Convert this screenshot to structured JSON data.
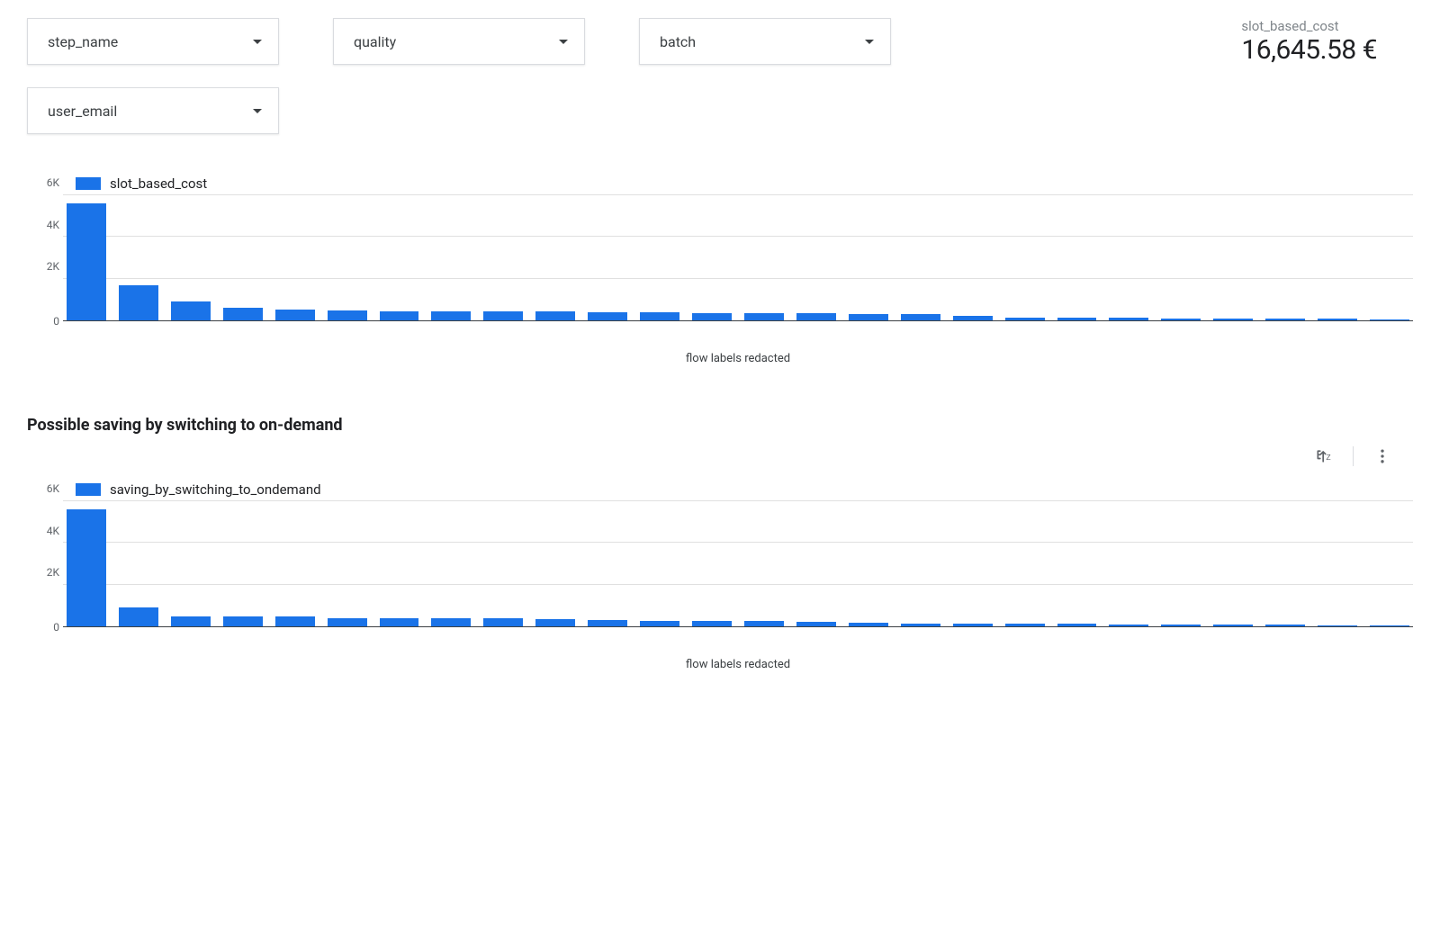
{
  "filters": {
    "step_name": {
      "label": "step_name"
    },
    "quality": {
      "label": "quality"
    },
    "batch": {
      "label": "batch"
    },
    "user_email": {
      "label": "user_email"
    }
  },
  "scorecard": {
    "label": "slot_based_cost",
    "value": "16,645.58 €"
  },
  "chart1": {
    "legend": "slot_based_cost",
    "x_caption": "flow labels redacted",
    "y_ticks": [
      "0",
      "2K",
      "4K",
      "6K"
    ]
  },
  "section2_heading": "Possible saving by switching to on-demand",
  "chart2": {
    "legend": "saving_by_switching_to_ondemand",
    "x_caption": "flow labels redacted",
    "y_ticks": [
      "0",
      "2K",
      "4K",
      "6K"
    ]
  },
  "chart_data": [
    {
      "type": "bar",
      "title": "slot_based_cost",
      "series_name": "slot_based_cost",
      "ylabel": "",
      "xlabel": "flow labels redacted",
      "ylim": [
        0,
        6000
      ],
      "y_ticks": [
        0,
        2000,
        4000,
        6000
      ],
      "values": [
        5600,
        1700,
        900,
        600,
        520,
        480,
        450,
        440,
        430,
        420,
        400,
        380,
        360,
        350,
        340,
        320,
        300,
        220,
        130,
        120,
        110,
        100,
        90,
        80,
        70,
        60
      ]
    },
    {
      "type": "bar",
      "title": "Possible saving by switching to on-demand",
      "series_name": "saving_by_switching_to_ondemand",
      "ylabel": "",
      "xlabel": "flow labels redacted",
      "ylim": [
        0,
        6000
      ],
      "y_ticks": [
        0,
        2000,
        4000,
        6000
      ],
      "values": [
        5600,
        900,
        480,
        470,
        460,
        400,
        390,
        380,
        370,
        350,
        300,
        280,
        260,
        240,
        220,
        180,
        150,
        130,
        120,
        110,
        100,
        90,
        80,
        70,
        65,
        60
      ]
    }
  ]
}
